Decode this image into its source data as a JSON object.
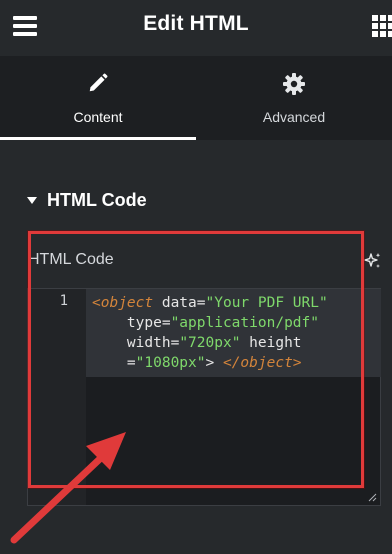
{
  "header": {
    "title": "Edit HTML",
    "menu_icon": "hamburger-menu-icon",
    "grid_icon": "apps-grid-icon"
  },
  "tabs": [
    {
      "label": "Content",
      "icon": "pencil-icon",
      "active": true
    },
    {
      "label": "Advanced",
      "icon": "gear-icon",
      "active": false
    }
  ],
  "section": {
    "title": "HTML Code",
    "expanded": true
  },
  "field": {
    "label": "HTML Code",
    "ai_icon": "sparkle-ai-icon"
  },
  "editor": {
    "line_number": "1",
    "code": "<object data=\"Your PDF URL\" type=\"application/pdf\" width=\"720px\" height=\"1080px\"> </object>"
  },
  "annotation": {
    "highlight_color": "#e03a3a",
    "arrow_color": "#e03a3a"
  },
  "colors": {
    "background": "#26292c",
    "tabs_background": "#1d1f22",
    "editor_background": "#1b1d20",
    "tag_color": "#d3843b",
    "string_color": "#7fd96b"
  }
}
